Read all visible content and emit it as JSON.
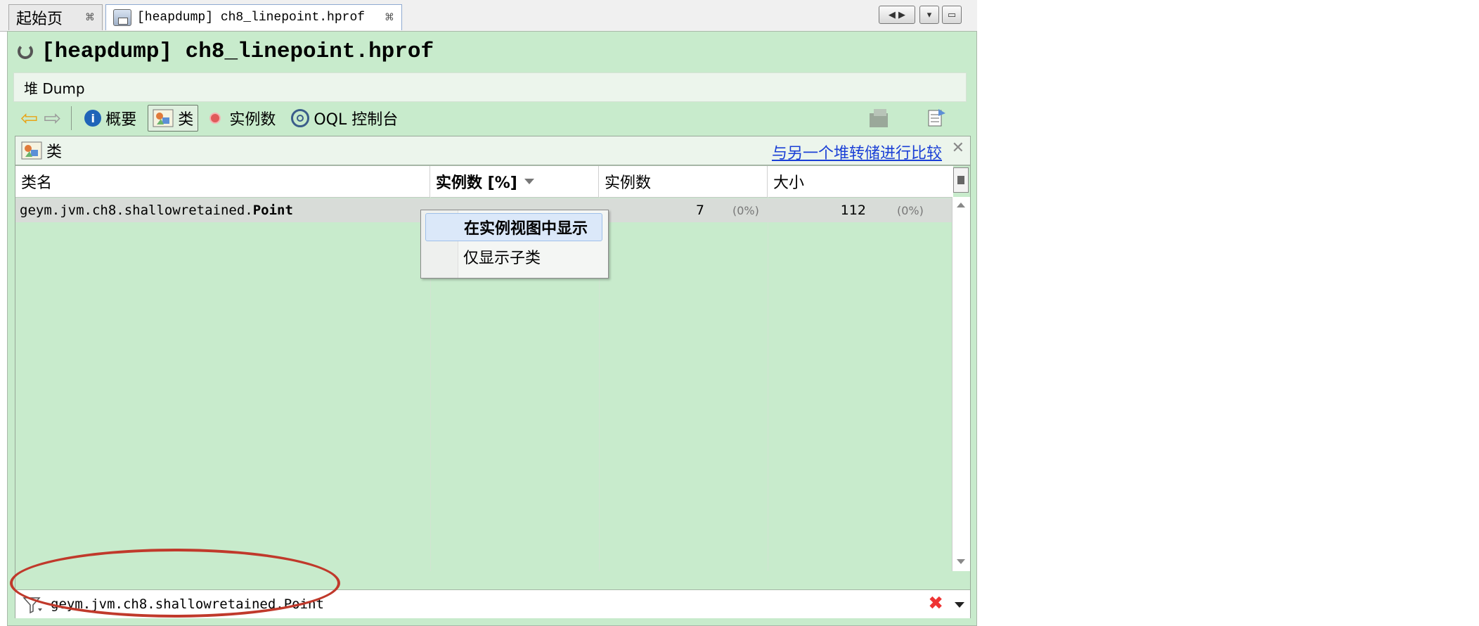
{
  "tabs": [
    {
      "label": "起始页",
      "close": "⌘"
    },
    {
      "label": "[heapdump] ch8_linepoint.hprof",
      "close": "⌘"
    }
  ],
  "window_controls": [
    "◀ ▶",
    "▾",
    "▭"
  ],
  "title": "[heapdump] ch8_linepoint.hprof",
  "subbar_label": "堆 Dump",
  "toolbar": {
    "summary": "概要",
    "classes": "类",
    "instances": "实例数",
    "oql": "OQL 控制台"
  },
  "classes_view": {
    "title": "类",
    "compare_link": "与另一个堆转储进行比较",
    "close": "✕"
  },
  "columns": [
    "类名",
    "实例数 [%]",
    "实例数",
    "大小"
  ],
  "rows": [
    {
      "name_prefix": "geym.jvm.ch8.shallowretained.",
      "name_bold": "Point",
      "instances": "7",
      "instances_pct": "(0%)",
      "size": "112",
      "size_pct": "(0%)"
    }
  ],
  "context_menu": {
    "items": [
      "在实例视图中显示",
      "仅显示子类"
    ]
  },
  "filter": {
    "value": "geym.jvm.ch8.shallowretained.Point"
  },
  "colors": {
    "panel_green": "#c8ebcc",
    "link_blue": "#1a3fd6",
    "highlight_red": "#c0392b"
  },
  "icons": [
    "spinner-icon",
    "back-arrow-icon",
    "forward-arrow-icon",
    "info-icon",
    "classes-icon",
    "instances-dot-icon",
    "oql-icon",
    "filter-icon",
    "clear-filter-icon",
    "dropdown-icon"
  ]
}
